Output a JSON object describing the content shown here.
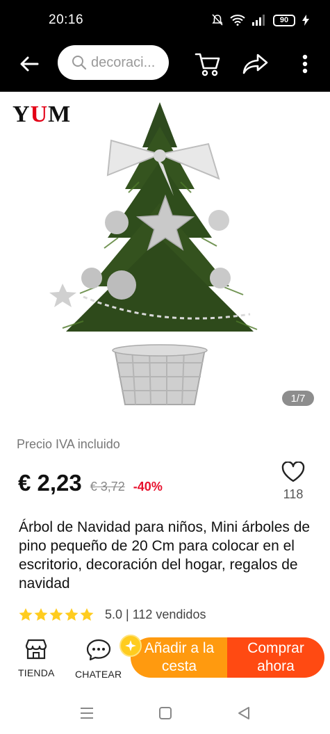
{
  "status_bar": {
    "time": "20:16",
    "battery": "90"
  },
  "header": {
    "search_placeholder": "decoraci...",
    "icons": [
      "back-arrow-icon",
      "search-icon",
      "cart-icon",
      "share-icon",
      "more-vertical-icon"
    ]
  },
  "gallery": {
    "brand": {
      "first": "Y",
      "accent": "U",
      "last": "M"
    },
    "counter": "1/7",
    "accent_color": "#e30016"
  },
  "price": {
    "note": "Precio IVA incluido",
    "current": "€ 2,23",
    "original": "€ 3,72",
    "discount": "-40%",
    "discount_color": "#e8112d"
  },
  "wishlist": {
    "count": "118"
  },
  "product": {
    "title": "Árbol de Navidad para niños, Mini árboles de pino pequeño de 20 Cm para colocar en el escritorio, decoración del hogar, regalos de navidad",
    "rating": 5.0,
    "rating_text": "5.0 | 112 vendidos",
    "star_color": "#ffcc1f"
  },
  "action_bar": {
    "store_label": "TIENDA",
    "chat_label": "CHATEAR",
    "add_to_cart_label": "Añadir a la cesta",
    "buy_now_label": "Comprar ahora",
    "cart_button_color": "#ff9a0f",
    "buy_button_color": "#ff4a12"
  },
  "system_nav": {
    "icons": [
      "menu-icon",
      "home-square-icon",
      "back-triangle-icon"
    ]
  }
}
